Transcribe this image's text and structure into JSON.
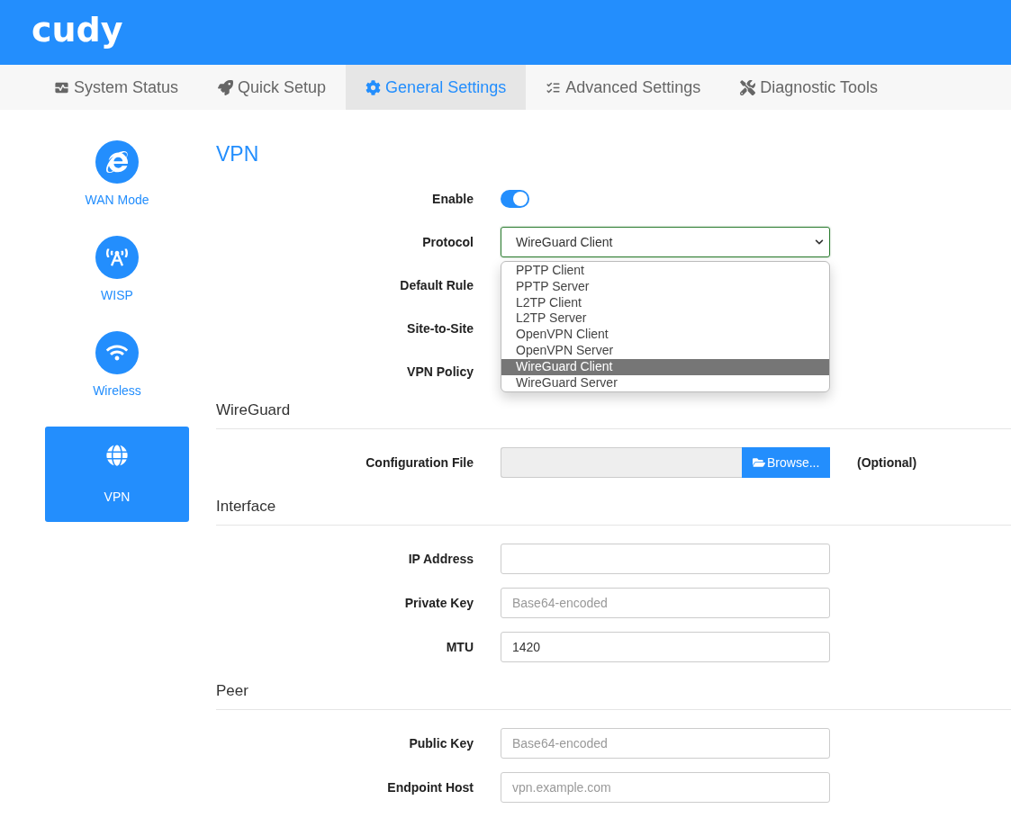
{
  "logo": "cudy",
  "nav": [
    {
      "label": "System Status",
      "selected": false
    },
    {
      "label": "Quick Setup",
      "selected": false
    },
    {
      "label": "General Settings",
      "selected": true
    },
    {
      "label": "Advanced Settings",
      "selected": false
    },
    {
      "label": "Diagnostic Tools",
      "selected": false
    }
  ],
  "sidebar": [
    {
      "label": "WAN Mode",
      "selected": false
    },
    {
      "label": "WISP",
      "selected": false
    },
    {
      "label": "Wireless",
      "selected": false
    },
    {
      "label": "VPN",
      "selected": true
    }
  ],
  "title": "VPN",
  "form": [
    {
      "label": "Enable",
      "kind": "switch",
      "on": true
    },
    {
      "label": "Protocol",
      "kind": "select",
      "value": "WireGuard Client",
      "expanded": true,
      "options": [
        {
          "label": "PPTP Client",
          "selected": false
        },
        {
          "label": "PPTP Server",
          "selected": false
        },
        {
          "label": "L2TP Client",
          "selected": false
        },
        {
          "label": "L2TP Server",
          "selected": false
        },
        {
          "label": "OpenVPN Client",
          "selected": false
        },
        {
          "label": "OpenVPN Server",
          "selected": false
        },
        {
          "label": "WireGuard Client",
          "selected": true
        },
        {
          "label": "WireGuard Server",
          "selected": false
        }
      ]
    },
    {
      "label": "Default Rule",
      "kind": "covered"
    },
    {
      "label": "Site-to-Site",
      "kind": "covered"
    },
    {
      "label": "VPN Policy",
      "kind": "covered"
    }
  ],
  "sections": [
    {
      "title": "WireGuard",
      "rows": [
        {
          "label": "Configuration File",
          "kind": "file",
          "button": "Browse...",
          "note": "(Optional)"
        }
      ]
    },
    {
      "title": "Interface",
      "rows": [
        {
          "label": "IP Address",
          "kind": "text"
        },
        {
          "label": "Private Key",
          "kind": "text",
          "placeholder": "Base64-encoded"
        },
        {
          "label": "MTU",
          "kind": "text",
          "value": "1420"
        }
      ]
    },
    {
      "title": "Peer",
      "rows": [
        {
          "label": "Public Key",
          "kind": "text",
          "placeholder": "Base64-encoded"
        },
        {
          "label": "Endpoint Host",
          "kind": "text",
          "placeholder": "vpn.example.com"
        }
      ]
    }
  ]
}
